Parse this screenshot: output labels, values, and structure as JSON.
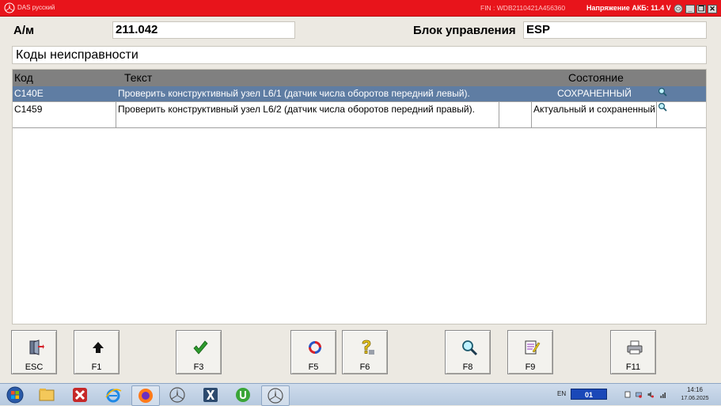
{
  "titlebar": {
    "app_title": "DAS русский",
    "fin": "FIN : WDB2110421A456360",
    "voltage": "Напряжение АКБ: 11.4 V",
    "min_label": "_",
    "restore_label": "❐",
    "close_label": "✕"
  },
  "header": {
    "am_label": "А/м",
    "am_value": "211.042",
    "ecu_label": "Блок управления",
    "ecu_value": "ESP"
  },
  "section_title": "Коды неисправности",
  "table": {
    "columns": {
      "code": "Код",
      "text": "Текст",
      "state": "Состояние"
    },
    "rows": [
      {
        "code": "C140E",
        "text": "Проверить конструктивный узел L6/1 (датчик числа оборотов передний левый).",
        "state": "СОХРАНЕННЫЙ",
        "selected": true
      },
      {
        "code": "C1459",
        "text": "Проверить конструктивный узел L6/2 (датчик числа оборотов передний правый).",
        "state": "Актуальный и сохраненный",
        "selected": false
      }
    ]
  },
  "fkeys": {
    "esc": "ESC",
    "f1": "F1",
    "f3": "F3",
    "f5": "F5",
    "f6": "F6",
    "f8": "F8",
    "f9": "F9",
    "f11": "F11"
  },
  "taskbar": {
    "lang": "EN",
    "indicator": "01",
    "time": "14:16",
    "date": "17.06.2025"
  },
  "colors": {
    "titlebar": "#e8141b",
    "selected_row": "#5f7da3",
    "table_header": "#808080"
  }
}
